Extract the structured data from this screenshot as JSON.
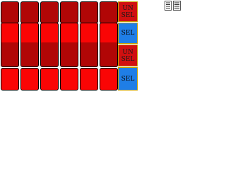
{
  "grid": {
    "columns": 6,
    "rows": [
      {
        "label_line1": "UN",
        "label_line2": "SEL",
        "state": "unselected",
        "shade": "dark"
      },
      {
        "label_line1": "SEL",
        "label_line2": "",
        "state": "selected",
        "shade": "split"
      },
      {
        "label_line1": "UN",
        "label_line2": "SEL",
        "state": "unselected",
        "shade": "dark"
      },
      {
        "label_line1": "SEL",
        "label_line2": "",
        "state": "selected",
        "shade": "bright"
      }
    ]
  },
  "colors": {
    "dark_red": "#b10606",
    "bright_red": "#fa0505",
    "unsel_button": "#d01010",
    "sel_button": "#1f7ee6",
    "button_border": "#c8a000"
  },
  "icons": {
    "corner": "list-view-icon"
  }
}
